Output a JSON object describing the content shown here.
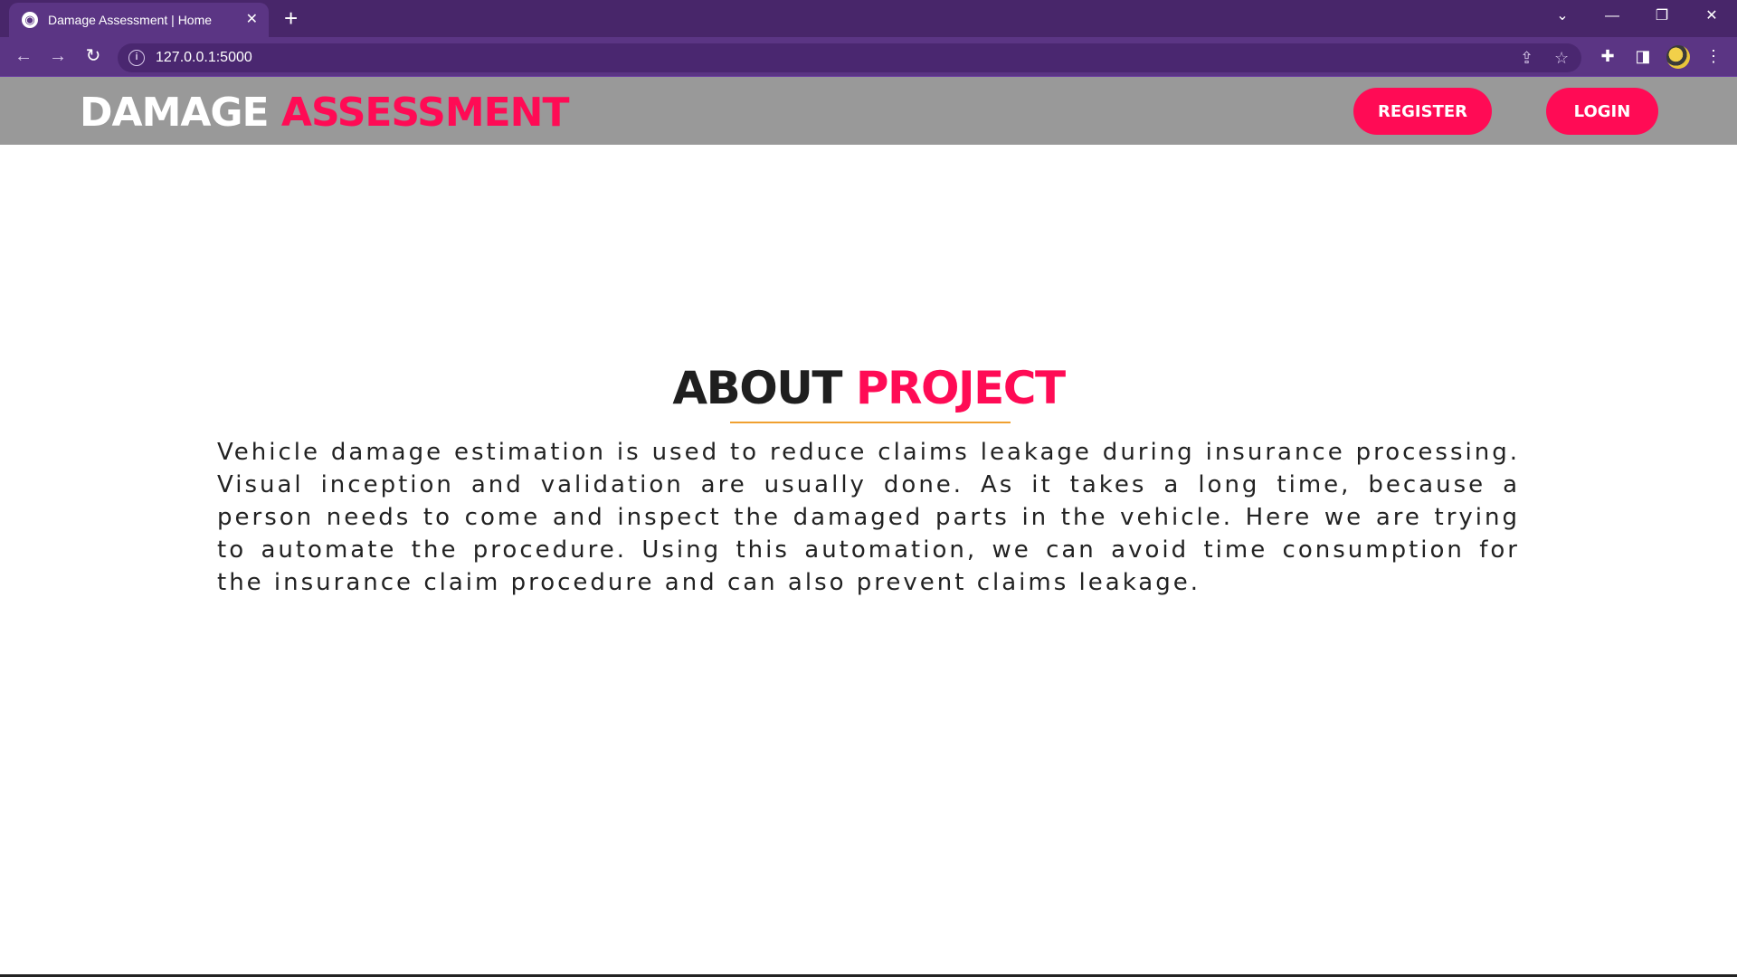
{
  "browser": {
    "tab_title": "Damage Assessment | Home",
    "new_tab_label": "+",
    "close_tab_label": "✕",
    "url": "127.0.0.1:5000",
    "back_glyph": "←",
    "forward_glyph": "→",
    "reload_glyph": "↻",
    "tab_search_glyph": "⌄",
    "minimize_glyph": "—",
    "restore_glyph": "❐",
    "close_window_glyph": "✕",
    "share_glyph": "⇪",
    "bookmark_glyph": "☆",
    "extensions_glyph": "✚",
    "sidepanel_glyph": "◨",
    "menu_glyph": "⋮",
    "info_glyph": "i",
    "favicon_glyph": "◉",
    "icons": [
      "back-icon",
      "forward-icon",
      "reload-icon",
      "info-icon",
      "share-icon",
      "star-icon",
      "puzzle-icon",
      "side-panel-icon",
      "avatar",
      "kebab-menu-icon"
    ],
    "theme_color": "#5b3584"
  },
  "header": {
    "brand_part1": "DAMAGE",
    "brand_part2": "ASSESSMENT",
    "register_label": "REGISTER",
    "login_label": "LOGIN",
    "accent_color": "#ff0b55",
    "background_color": "#999999"
  },
  "about": {
    "title_part1": "ABOUT",
    "title_part2": "PROJECT",
    "body": "Vehicle damage estimation is used to reduce claims leakage during insurance processing. Visual inception and validation are usually done. As it takes a long time, because a person needs to come and inspect the damaged parts in the vehicle. Here we are trying to automate the procedure. Using this automation, we can avoid time consumption for the insurance claim procedure and can also prevent claims leakage."
  }
}
